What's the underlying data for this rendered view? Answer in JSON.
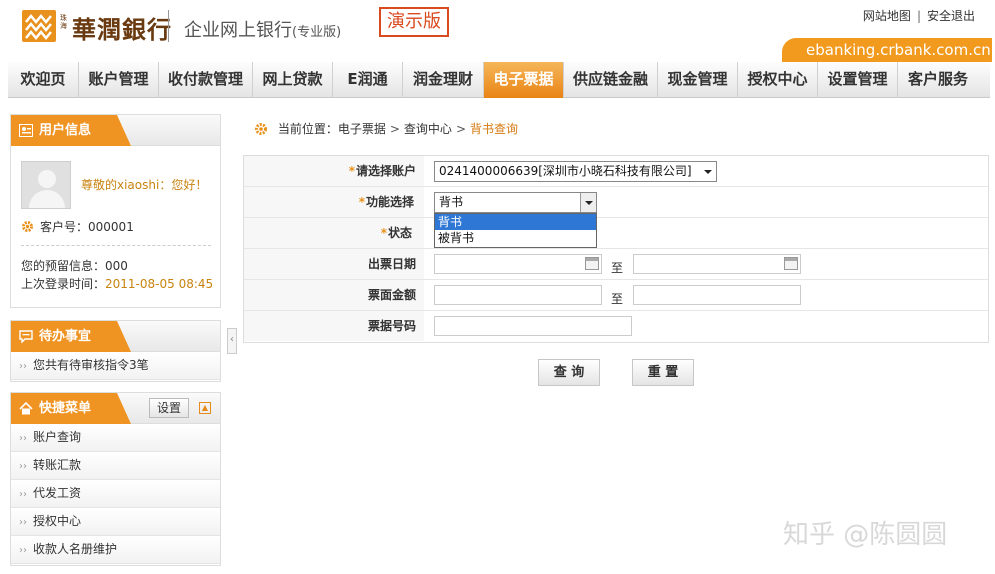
{
  "header": {
    "logo_small_text": "珠海",
    "logo_text": "華潤銀行",
    "bank_name": "企业网上银行",
    "bank_edition": "(专业版)",
    "demo_badge": "演示版",
    "links": {
      "sitemap": "网站地图",
      "separator": "|",
      "logout": "安全退出"
    },
    "url": "ebanking.crbank.com.cn",
    "accent_color": "#f29a1e"
  },
  "nav": {
    "items": [
      {
        "label": "欢迎页"
      },
      {
        "label": "账户管理"
      },
      {
        "label": "收付款管理"
      },
      {
        "label": "网上贷款"
      },
      {
        "label": "E润通"
      },
      {
        "label": "润金理财"
      },
      {
        "label": "电子票据"
      },
      {
        "label": "供应链金融"
      },
      {
        "label": "现金管理"
      },
      {
        "label": "授权中心"
      },
      {
        "label": "设置管理"
      },
      {
        "label": "客户服务"
      }
    ],
    "active_index": 6
  },
  "user_info": {
    "title": "用户信息",
    "greeting": "尊敬的xiaoshi：您好！",
    "customer_label": "客户号：",
    "customer_no": "000001",
    "reserved_label": "您的预留信息：",
    "reserved_value": "000",
    "last_login_label": "上次登录时间：",
    "last_login_value": "2011-08-05 08:45"
  },
  "todo": {
    "title": "待办事宜",
    "items": [
      {
        "label": "您共有待审核指令3笔"
      }
    ]
  },
  "quick_menu": {
    "title": "快捷菜单",
    "settings_label": "设置",
    "items": [
      {
        "label": "账户查询"
      },
      {
        "label": "转账汇款"
      },
      {
        "label": "代发工资"
      },
      {
        "label": "授权中心"
      },
      {
        "label": "收款人名册维护"
      }
    ]
  },
  "breadcrumb": {
    "prefix": "当前位置：",
    "items": [
      "电子票据",
      "查询中心",
      "背书查询"
    ],
    "separator": ">"
  },
  "form": {
    "account": {
      "label": "请选择账户",
      "value": "0241400006639[深圳市小晓石科技有限公司]"
    },
    "function": {
      "label": "功能选择",
      "value": "背书",
      "options": [
        "背书",
        "被背书"
      ],
      "highlighted_index": 0
    },
    "status": {
      "label": "状态"
    },
    "issue_date": {
      "label": "出票日期",
      "from": "",
      "to": "",
      "range_sep": "至"
    },
    "amount": {
      "label": "票面金额",
      "from": "",
      "to": "",
      "range_sep": "至"
    },
    "bill_no": {
      "label": "票据号码",
      "value": ""
    },
    "required_mark": "*"
  },
  "buttons": {
    "query": "查 询",
    "reset": "重 置"
  },
  "watermark": "知乎 @陈圆圆"
}
